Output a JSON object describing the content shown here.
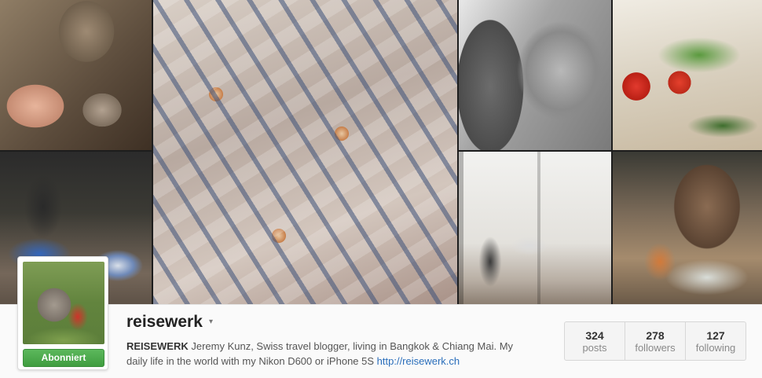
{
  "profile": {
    "username": "reisewerk",
    "follow_label": "Abonniert",
    "bio_name": "REISEWERK",
    "bio_text_1": " Jeremy Kunz, Swiss travel blogger, living in Bangkok & Chiang Mai. My daily life in the world with my Nikon D600 or iPhone 5S ",
    "bio_link": "http://reisewerk.ch"
  },
  "stats": [
    {
      "count": "324",
      "label": "posts"
    },
    {
      "count": "278",
      "label": "followers"
    },
    {
      "count": "127",
      "label": "following"
    }
  ],
  "icons": {
    "username_caret": "▾"
  },
  "colors": {
    "follow_button": "#4cae4c",
    "link": "#2a6ebb"
  }
}
